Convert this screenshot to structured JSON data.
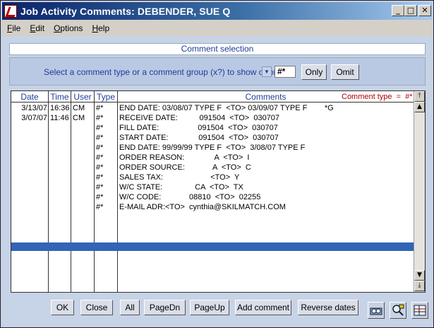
{
  "window": {
    "title": "Job Activity Comments:  DEBENDER, SUE Q",
    "min": "_",
    "max": "□",
    "close": "✕"
  },
  "menu": {
    "file": {
      "u": "F",
      "rest": "ile"
    },
    "edit": {
      "u": "E",
      "rest": "dit"
    },
    "options": {
      "u": "O",
      "rest": "ptions"
    },
    "help": {
      "u": "H",
      "rest": "elp"
    }
  },
  "selection": {
    "header": "Comment selection",
    "label": "Select a comment type or a comment group (x?) to show or omit",
    "value": "#*",
    "only": "Only",
    "omit": "Omit"
  },
  "grid": {
    "columns": {
      "date": "Date",
      "time": "Time",
      "user": "User",
      "type": "Type",
      "comments": "Comments"
    },
    "type_indicator": "Comment type  =  #*",
    "rows": [
      {
        "date": "3/13/07",
        "time": "16:36",
        "user": "CM",
        "type": "#*",
        "comment": "END DATE: 03/08/07 TYPE F  <TO> 03/09/07 TYPE F        *G"
      },
      {
        "date": "3/07/07",
        "time": "11:46",
        "user": "CM",
        "type": "#*",
        "comment": "RECEIVE DATE:          091504  <TO>  030707"
      },
      {
        "date": "",
        "time": "",
        "user": "",
        "type": "#*",
        "comment": "FILL DATE:                  091504  <TO>  030707"
      },
      {
        "date": "",
        "time": "",
        "user": "",
        "type": "#*",
        "comment": "START DATE:              091504  <TO>  030707"
      },
      {
        "date": "",
        "time": "",
        "user": "",
        "type": "#*",
        "comment": "END DATE: 99/99/99 TYPE F  <TO>  3/08/07 TYPE F"
      },
      {
        "date": "",
        "time": "",
        "user": "",
        "type": "#*",
        "comment": "ORDER REASON:              A  <TO>  I"
      },
      {
        "date": "",
        "time": "",
        "user": "",
        "type": "#*",
        "comment": "ORDER SOURCE:             A  <TO>  C"
      },
      {
        "date": "",
        "time": "",
        "user": "",
        "type": "#*",
        "comment": "SALES TAX:                      <TO>  Y"
      },
      {
        "date": "",
        "time": "",
        "user": "",
        "type": "#*",
        "comment": "W/C STATE:               CA  <TO>  TX"
      },
      {
        "date": "",
        "time": "",
        "user": "",
        "type": "#*",
        "comment": "W/C CODE:             08810  <TO>  02255"
      },
      {
        "date": "",
        "time": "",
        "user": "",
        "type": "#*",
        "comment": "E-MAIL ADR:<TO>  cynthia@SKILMATCH.COM"
      }
    ]
  },
  "buttons": {
    "ok": "OK",
    "close": "Close",
    "all": "All",
    "pagedn": "PageDn",
    "pageup": "PageUp",
    "add_comment": "Add comment",
    "reverse_dates": "Reverse dates"
  },
  "scroll": {
    "top": "⤒",
    "up": "▲",
    "down": "▼",
    "bottom": "⤓"
  },
  "colors": {
    "accent": "#1f3d99",
    "selection": "#3264b7",
    "type_red": "#b00000"
  },
  "icons": [
    "list-view-icon",
    "find-icon",
    "grid-view-icon"
  ]
}
